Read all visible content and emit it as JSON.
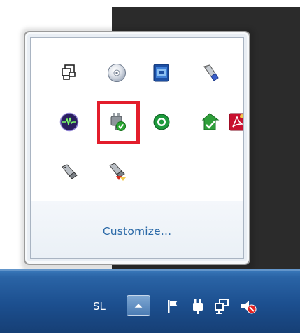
{
  "popup": {
    "customize_label": "Customize...",
    "icons": [
      {
        "name": "network-windows-icon"
      },
      {
        "name": "optical-disc-icon"
      },
      {
        "name": "blue-app-icon"
      },
      {
        "name": "usb-plug-icon"
      },
      {
        "name": "audio-visualizer-icon"
      },
      {
        "name": "safely-remove-hardware-icon"
      },
      {
        "name": "green-circle-app-icon"
      },
      {
        "name": "green-sync-icon"
      },
      {
        "name": "pdf-reader-icon"
      },
      {
        "name": "usb-connector-icon"
      },
      {
        "name": "usb-device-error-icon"
      }
    ]
  },
  "taskbar": {
    "language_label": "SL"
  },
  "colors": {
    "highlight": "#e31d2b",
    "link": "#2c6aa8",
    "taskbar": "#1c4f8f"
  }
}
